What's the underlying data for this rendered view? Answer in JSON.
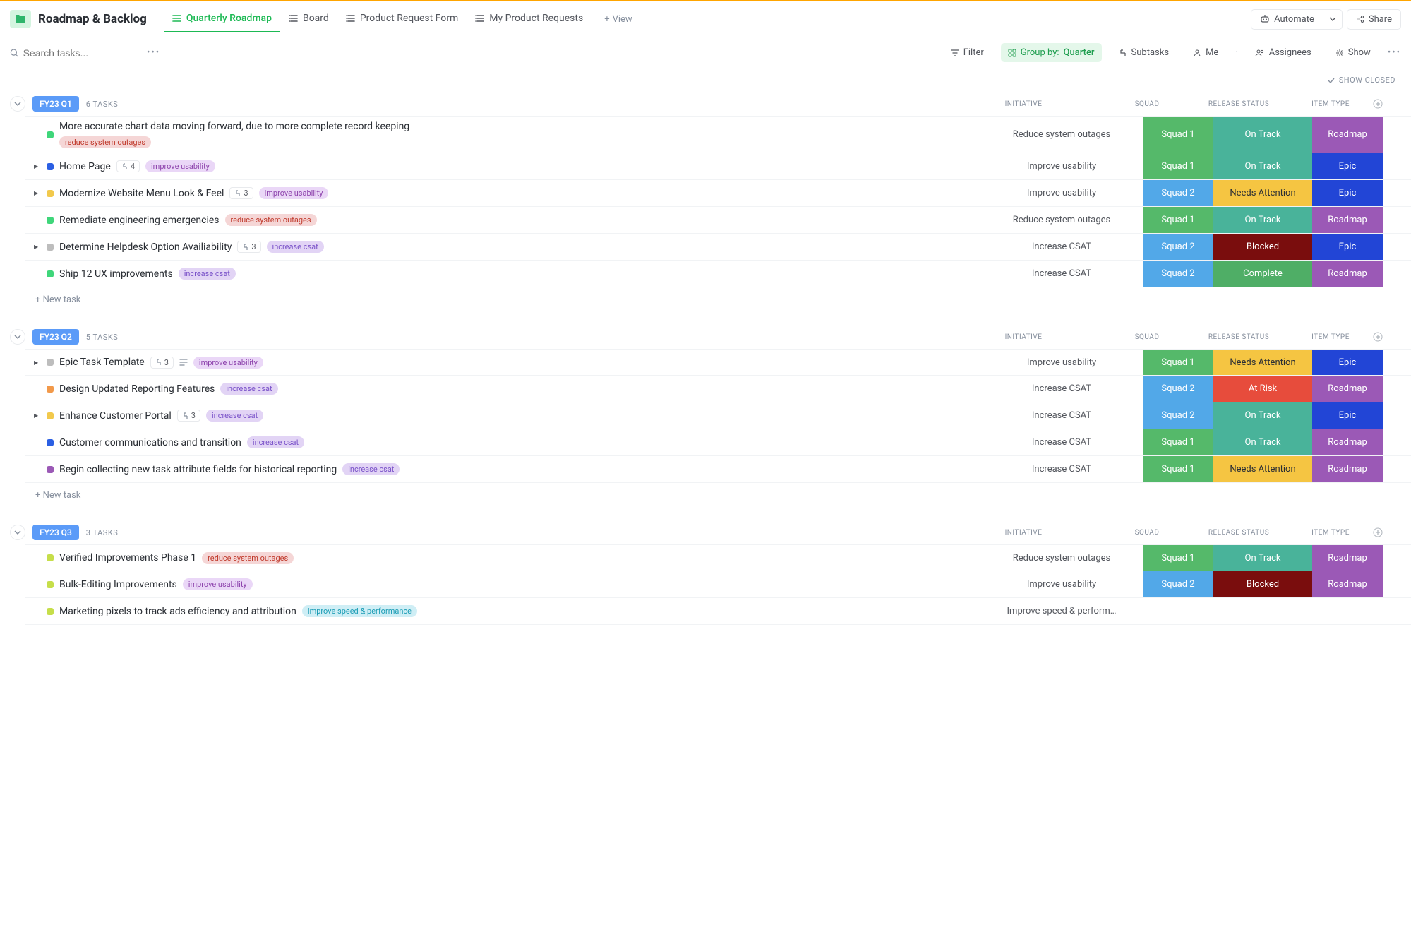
{
  "header": {
    "title": "Roadmap & Backlog",
    "tabs": [
      {
        "label": "Quarterly Roadmap",
        "active": true
      },
      {
        "label": "Board",
        "active": false
      },
      {
        "label": "Product Request Form",
        "active": false
      },
      {
        "label": "My Product Requests",
        "active": false
      }
    ],
    "add_view": "View",
    "automate": "Automate",
    "share": "Share"
  },
  "toolbar": {
    "search_placeholder": "Search tasks...",
    "filter": "Filter",
    "group_by_label": "Group by:",
    "group_by_value": "Quarter",
    "subtasks": "Subtasks",
    "me": "Me",
    "assignees": "Assignees",
    "show": "Show"
  },
  "show_closed": "SHOW CLOSED",
  "columns": {
    "initiative": "INITIATIVE",
    "squad": "SQUAD",
    "release_status": "RELEASE STATUS",
    "item_type": "ITEM TYPE"
  },
  "new_task": "+ New task",
  "colors": {
    "tag_reduce": {
      "bg": "#f5d6d6",
      "fg": "#c0392b"
    },
    "tag_usability": {
      "bg": "#ead7f7",
      "fg": "#8e44ad"
    },
    "tag_csat": {
      "bg": "#e2d4f5",
      "fg": "#7a52c9"
    },
    "tag_speed": {
      "bg": "#cfeef5",
      "fg": "#1a9cb5"
    },
    "squad1": "#55b96a",
    "squad2": "#52a8e8",
    "ontrack": "#49b39a",
    "needs": "#f5c542",
    "blocked": "#7a0d0d",
    "complete": "#4fae66",
    "atrisk": "#e74c3c",
    "roadmap": "#9b59b6",
    "epic": "#2245d6",
    "st_green": "#3fd67a",
    "st_blue": "#2b5fe3",
    "st_yellow": "#f2c94c",
    "st_orange": "#f2994a",
    "st_grey": "#bdbdbd",
    "st_purple": "#9b59b6",
    "st_lime": "#c6de4a"
  },
  "groups": [
    {
      "name": "FY23 Q1",
      "count": "6 TASKS",
      "rows": [
        {
          "expand": false,
          "status": "st_green",
          "title": "More accurate chart data moving forward, due to more complete record keeping",
          "tags": [
            "reduce system outages"
          ],
          "tag_style": "tag_reduce",
          "multiline": true,
          "initiative": "Reduce system outages",
          "squad": "Squad 1",
          "squad_c": "squad1",
          "release": "On Track",
          "release_c": "ontrack",
          "type": "Roadmap",
          "type_c": "roadmap"
        },
        {
          "expand": true,
          "status": "st_blue",
          "title": "Home Page",
          "sub": "4",
          "tags": [
            "improve usability"
          ],
          "tag_style": "tag_usability",
          "initiative": "Improve usability",
          "squad": "Squad 1",
          "squad_c": "squad1",
          "release": "On Track",
          "release_c": "ontrack",
          "type": "Epic",
          "type_c": "epic"
        },
        {
          "expand": true,
          "status": "st_yellow",
          "title": "Modernize Website Menu Look & Feel",
          "sub": "3",
          "tags": [
            "improve usability"
          ],
          "tag_style": "tag_usability",
          "initiative": "Improve usability",
          "squad": "Squad 2",
          "squad_c": "squad2",
          "release": "Needs Attention",
          "release_c": "needs",
          "type": "Epic",
          "type_c": "epic"
        },
        {
          "expand": false,
          "status": "st_green",
          "title": "Remediate engineering emergencies",
          "tags": [
            "reduce system outages"
          ],
          "tag_style": "tag_reduce",
          "initiative": "Reduce system outages",
          "squad": "Squad 1",
          "squad_c": "squad1",
          "release": "On Track",
          "release_c": "ontrack",
          "type": "Roadmap",
          "type_c": "roadmap"
        },
        {
          "expand": true,
          "status": "st_grey",
          "title": "Determine Helpdesk Option Availiability",
          "sub": "3",
          "tags": [
            "increase csat"
          ],
          "tag_style": "tag_csat",
          "initiative": "Increase CSAT",
          "squad": "Squad 2",
          "squad_c": "squad2",
          "release": "Blocked",
          "release_c": "blocked",
          "type": "Epic",
          "type_c": "epic"
        },
        {
          "expand": false,
          "status": "st_green",
          "title": "Ship 12 UX improvements",
          "tags": [
            "increase csat"
          ],
          "tag_style": "tag_csat",
          "initiative": "Increase CSAT",
          "squad": "Squad 2",
          "squad_c": "squad2",
          "release": "Complete",
          "release_c": "complete",
          "type": "Roadmap",
          "type_c": "roadmap"
        }
      ]
    },
    {
      "name": "FY23 Q2",
      "count": "5 TASKS",
      "rows": [
        {
          "expand": true,
          "status": "st_grey",
          "title": "Epic Task Template",
          "sub": "3",
          "desc_icon": true,
          "tags": [
            "improve usability"
          ],
          "tag_style": "tag_usability",
          "initiative": "Improve usability",
          "squad": "Squad 1",
          "squad_c": "squad1",
          "release": "Needs Attention",
          "release_c": "needs",
          "type": "Epic",
          "type_c": "epic"
        },
        {
          "expand": false,
          "status": "st_orange",
          "title": "Design Updated Reporting Features",
          "tags": [
            "increase csat"
          ],
          "tag_style": "tag_csat",
          "initiative": "Increase CSAT",
          "squad": "Squad 2",
          "squad_c": "squad2",
          "release": "At Risk",
          "release_c": "atrisk",
          "type": "Roadmap",
          "type_c": "roadmap"
        },
        {
          "expand": true,
          "status": "st_yellow",
          "title": "Enhance Customer Portal",
          "sub": "3",
          "tags": [
            "increase csat"
          ],
          "tag_style": "tag_csat",
          "initiative": "Increase CSAT",
          "squad": "Squad 2",
          "squad_c": "squad2",
          "release": "On Track",
          "release_c": "ontrack",
          "type": "Epic",
          "type_c": "epic"
        },
        {
          "expand": false,
          "status": "st_blue",
          "title": "Customer communications and transition",
          "tags": [
            "increase csat"
          ],
          "tag_style": "tag_csat",
          "initiative": "Increase CSAT",
          "squad": "Squad 1",
          "squad_c": "squad1",
          "release": "On Track",
          "release_c": "ontrack",
          "type": "Roadmap",
          "type_c": "roadmap"
        },
        {
          "expand": false,
          "status": "st_purple",
          "title": "Begin collecting new task attribute fields for historical reporting",
          "tags": [
            "increase csat"
          ],
          "tag_style": "tag_csat",
          "initiative": "Increase CSAT",
          "squad": "Squad 1",
          "squad_c": "squad1",
          "release": "Needs Attention",
          "release_c": "needs",
          "type": "Roadmap",
          "type_c": "roadmap"
        }
      ]
    },
    {
      "name": "FY23 Q3",
      "count": "3 TASKS",
      "rows": [
        {
          "expand": false,
          "status": "st_lime",
          "title": "Verified Improvements Phase 1",
          "tags": [
            "reduce system outages"
          ],
          "tag_style": "tag_reduce",
          "initiative": "Reduce system outages",
          "squad": "Squad 1",
          "squad_c": "squad1",
          "release": "On Track",
          "release_c": "ontrack",
          "type": "Roadmap",
          "type_c": "roadmap"
        },
        {
          "expand": false,
          "status": "st_lime",
          "title": "Bulk-Editing Improvements",
          "tags": [
            "improve usability"
          ],
          "tag_style": "tag_usability",
          "initiative": "Improve usability",
          "squad": "Squad 2",
          "squad_c": "squad2",
          "release": "Blocked",
          "release_c": "blocked",
          "type": "Roadmap",
          "type_c": "roadmap"
        },
        {
          "expand": false,
          "status": "st_lime",
          "title": "Marketing pixels to track ads efficiency and attribution",
          "tags": [
            "improve speed & performance"
          ],
          "tag_style": "tag_speed",
          "initiative": "Improve speed & perform…",
          "squad": "",
          "squad_c": "",
          "release": "",
          "release_c": "",
          "type": "",
          "type_c": ""
        }
      ]
    }
  ]
}
